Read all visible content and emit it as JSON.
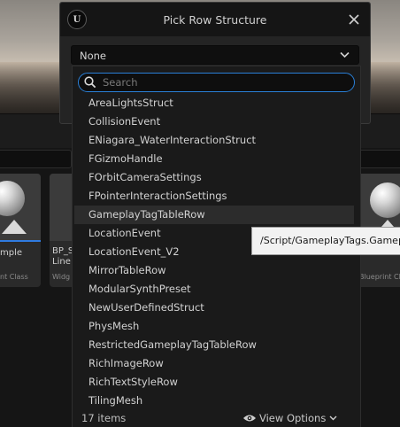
{
  "dialog": {
    "title": "Pick Row Structure",
    "logo_text": "U",
    "selected_value": "None"
  },
  "search": {
    "placeholder": "Search",
    "value": ""
  },
  "rows": [
    "AreaLightsStruct",
    "CollisionEvent",
    "ENiagara_WaterInteractionStruct",
    "FGizmoHandle",
    "FOrbitCameraSettings",
    "FPointerInteractionSettings",
    "GameplayTagTableRow",
    "LocationEvent",
    "LocationEvent_V2",
    "MirrorTableRow",
    "ModularSynthPreset",
    "NewUserDefinedStruct",
    "PhysMesh",
    "RestrictedGameplayTagTableRow",
    "RichImageRow",
    "RichTextStyleRow",
    "TilingMesh"
  ],
  "hovered_row": "GameplayTagTableRow",
  "footer": {
    "item_count": "17 items",
    "view_options": "View Options"
  },
  "tooltip": {
    "text": "/Script/GameplayTags.GameplayTagTableRow"
  },
  "background": {
    "tile_left_title": "mple",
    "tile_left_sub": "nt Class",
    "tile_mid_title": "BP_S",
    "tile_mid_title2": "Line",
    "tile_mid_sub": "Widg",
    "tile_right_sub": "Blueprint Cl"
  },
  "colors": {
    "accent": "#2a80d8",
    "dropdown_bg": "#1a1a1a",
    "hover_row": "#2c2c2c",
    "tooltip_bg": "#f2f2f2"
  },
  "icons": {
    "logo": "unreal-logo-icon",
    "close": "close-icon",
    "combo": "chevron-down-icon",
    "search": "search-icon",
    "view_options": "eye-icon"
  }
}
